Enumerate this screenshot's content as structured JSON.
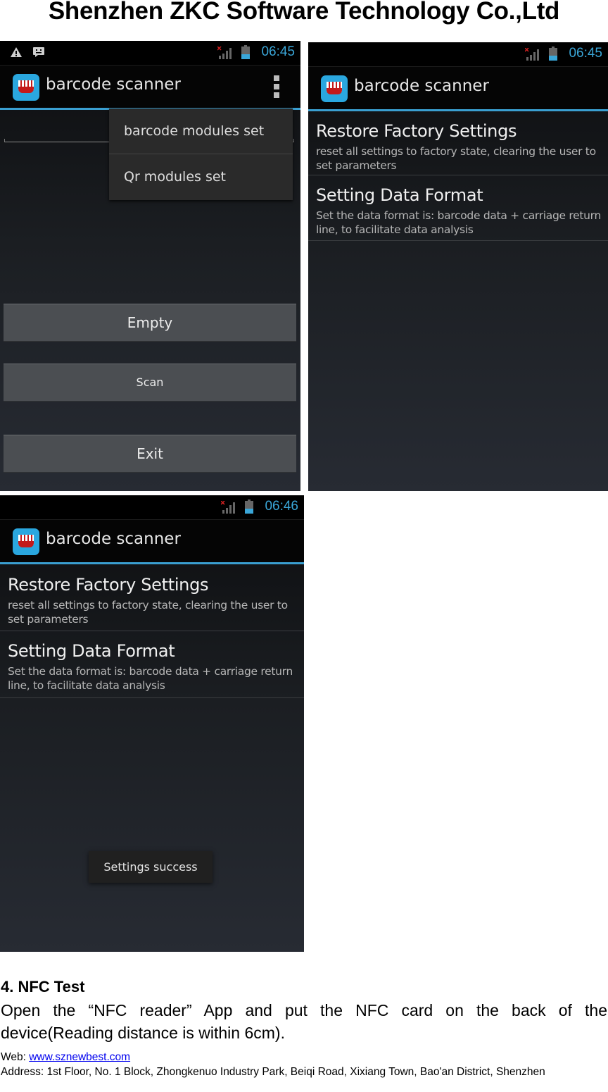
{
  "document": {
    "header_title": "Shenzhen ZKC Software Technology Co.,Ltd",
    "section_heading": "4. NFC Test",
    "paragraph": "Open the “NFC reader” App and put the NFC card on the back of the device(Reading distance is within 6cm).",
    "footer": {
      "web_label": "Web: ",
      "web_link": "www.sznewbest.com",
      "address": "Address: 1st Floor, No. 1 Block, Zhongkenuo Industry Park, Beiqi Road, Xixiang Town, Bao'an District, Shenzhen"
    }
  },
  "screenshots": [
    {
      "status_time": "06:45",
      "status_icons": [
        "warning-icon",
        "chat-notification-icon",
        "signal-no-sim-icon",
        "battery-icon"
      ],
      "app_title": "barcode scanner",
      "overflow_menu": [
        "barcode modules set",
        "Qr modules set"
      ],
      "buttons": [
        "Empty",
        "Scan",
        "Exit"
      ]
    },
    {
      "status_time": "06:45",
      "app_title": "barcode scanner",
      "preferences": [
        {
          "title": "Restore Factory Settings",
          "summary": "reset all settings to factory state, clearing the user to set parameters"
        },
        {
          "title": "Setting Data Format",
          "summary": "Set the data format is: barcode data + carriage return line, to facilitate data analysis"
        }
      ]
    },
    {
      "status_time": "06:46",
      "app_title": "barcode scanner",
      "preferences": [
        {
          "title": "Restore Factory Settings",
          "summary": "reset all settings to factory state, clearing the user to set parameters"
        },
        {
          "title": "Setting Data Format",
          "summary": "Set the data format is: barcode data + carriage return line, to facilitate data analysis"
        }
      ],
      "toast": "Settings success"
    }
  ],
  "colors": {
    "accent": "#3a9fd1",
    "status_text": "#3aa6d8",
    "app_icon_bg": "#2aa7df",
    "link": "#0000ee"
  }
}
